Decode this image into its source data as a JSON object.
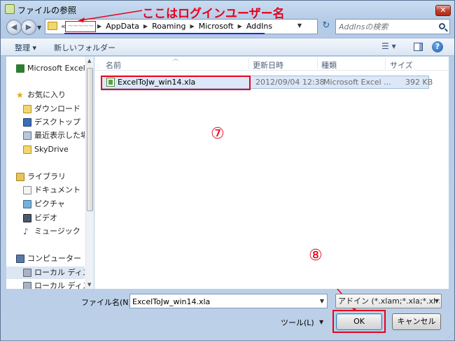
{
  "title": "ファイルの参照",
  "annotation_text": "ここはログインユーザー名",
  "address": {
    "user_placeholder": "~~~~~",
    "crumbs": [
      "AppData",
      "Roaming",
      "Microsoft",
      "AddIns"
    ]
  },
  "search": {
    "placeholder": "AddInsの検索"
  },
  "toolbar": {
    "organize_label": "整理 ▾",
    "new_folder_label": "新しいフォルダー"
  },
  "sidebar": {
    "items": [
      {
        "label": "Microsoft Excel",
        "icon": "excel-icon"
      },
      {
        "label": "お気に入り",
        "icon": "favorites-star-icon"
      },
      {
        "label": "ダウンロード",
        "icon": "download-folder-icon"
      },
      {
        "label": "デスクトップ",
        "icon": "desktop-icon"
      },
      {
        "label": "最近表示した場所",
        "icon": "recent-places-icon"
      },
      {
        "label": "SkyDrive",
        "icon": "folder-icon"
      },
      {
        "label": "ライブラリ",
        "icon": "library-icon"
      },
      {
        "label": "ドキュメント",
        "icon": "documents-icon"
      },
      {
        "label": "ピクチャ",
        "icon": "pictures-icon"
      },
      {
        "label": "ビデオ",
        "icon": "videos-icon"
      },
      {
        "label": "ミュージック",
        "icon": "music-icon"
      },
      {
        "label": "コンピューター",
        "icon": "computer-icon"
      },
      {
        "label": "ローカル ディスク",
        "icon": "local-disk-icon"
      },
      {
        "label": "ローカル ディスク",
        "icon": "local-disk-icon"
      }
    ]
  },
  "columns": [
    "名前",
    "更新日時",
    "種類",
    "サイズ"
  ],
  "files": [
    {
      "name": "ExcelToJw_win14.xla",
      "date": "2012/09/04 12:38",
      "type": "Microsoft Excel ...",
      "size": "392 KB"
    }
  ],
  "step_markers": [
    "⑦",
    "⑧"
  ],
  "bottom": {
    "filename_label": "ファイル名(N):",
    "filename_value": "ExcelToJw_win14.xla",
    "filetype": "アドイン (*.xlam;*.xla;*.xll;",
    "tools_label": "ツール(L)",
    "ok_label": "OK",
    "cancel_label": "キャンセル"
  },
  "colors": {
    "annotation": "#e8001c",
    "underline": "#1a2ed8"
  }
}
